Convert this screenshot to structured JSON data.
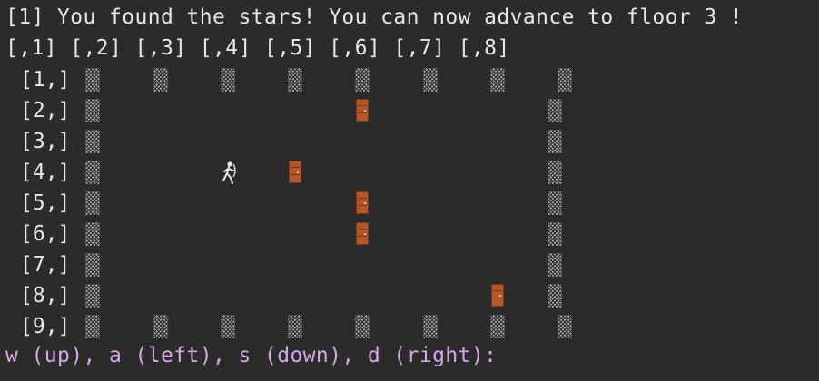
{
  "message": "[1] You found the stars! You can now advance to floor 3 !",
  "column_header": "[,1] [,2] [,3] [,4] [,5] [,6] [,7] [,8]",
  "row_labels": [
    "[1,]",
    "[2,]",
    "[3,]",
    "[4,]",
    "[5,]",
    "[6,]",
    "[7,]",
    "[8,]",
    "[9,]"
  ],
  "prompt": "w (up), a (left), s (down), d (right):",
  "board": {
    "rows": 9,
    "cols": 8,
    "walls": [
      [
        1,
        1
      ],
      [
        1,
        2
      ],
      [
        1,
        3
      ],
      [
        1,
        4
      ],
      [
        1,
        5
      ],
      [
        1,
        6
      ],
      [
        1,
        7
      ],
      [
        1,
        8
      ],
      [
        2,
        1
      ],
      [
        2,
        8
      ],
      [
        3,
        1
      ],
      [
        3,
        8
      ],
      [
        4,
        1
      ],
      [
        4,
        8
      ],
      [
        5,
        1
      ],
      [
        5,
        8
      ],
      [
        6,
        1
      ],
      [
        6,
        8
      ],
      [
        7,
        1
      ],
      [
        7,
        8
      ],
      [
        8,
        1
      ],
      [
        8,
        8
      ],
      [
        9,
        1
      ],
      [
        9,
        2
      ],
      [
        9,
        3
      ],
      [
        9,
        4
      ],
      [
        9,
        5
      ],
      [
        9,
        6
      ],
      [
        9,
        7
      ],
      [
        9,
        8
      ]
    ],
    "doors": [
      [
        2,
        5
      ],
      [
        4,
        4
      ],
      [
        5,
        5
      ],
      [
        6,
        5
      ],
      [
        8,
        7
      ]
    ],
    "player": [
      4,
      3
    ]
  },
  "colors": {
    "background": "#2b2b2b",
    "text": "#e6e6e6",
    "prompt": "#d7a6e8",
    "door": "#b3582d"
  }
}
